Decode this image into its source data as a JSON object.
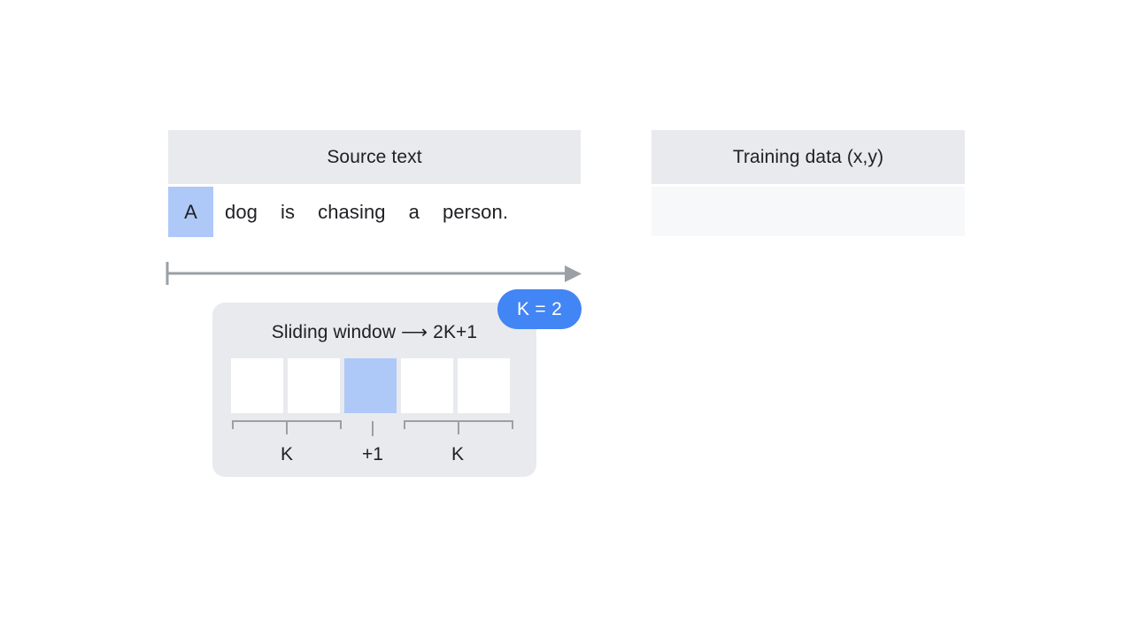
{
  "colors": {
    "panel_header_bg": "#e8eaed",
    "panel_body_bg": "#f7f8fa",
    "highlight_blue": "#aec8f8",
    "badge_blue": "#4285f4",
    "text": "#202124",
    "line_gray": "#9aa0a6",
    "card_bg": "#e8eaed",
    "page_bg": "#ffffff"
  },
  "source_panel": {
    "title": "Source text",
    "tokens": [
      {
        "text": "A",
        "highlighted": true
      },
      {
        "text": "dog",
        "highlighted": false
      },
      {
        "text": "is",
        "highlighted": false
      },
      {
        "text": "chasing",
        "highlighted": false
      },
      {
        "text": "a",
        "highlighted": false
      },
      {
        "text": "person.",
        "highlighted": false
      }
    ]
  },
  "timeline": {
    "icon": "arrow-right-icon",
    "start_tick": true,
    "direction": "left-to-right"
  },
  "training_panel": {
    "title": "Training data (x,y)",
    "rows": []
  },
  "sliding_window": {
    "title": "Sliding window ⟶ 2K+1",
    "cells": [
      {
        "index": 0,
        "highlighted": false
      },
      {
        "index": 1,
        "highlighted": false
      },
      {
        "index": 2,
        "highlighted": true
      },
      {
        "index": 3,
        "highlighted": false
      },
      {
        "index": 4,
        "highlighted": false
      }
    ],
    "brackets": [
      {
        "label": "K",
        "span": "left"
      },
      {
        "label": "+1",
        "span": "center"
      },
      {
        "label": "K",
        "span": "right"
      }
    ]
  },
  "badge": {
    "label": "K = 2"
  }
}
